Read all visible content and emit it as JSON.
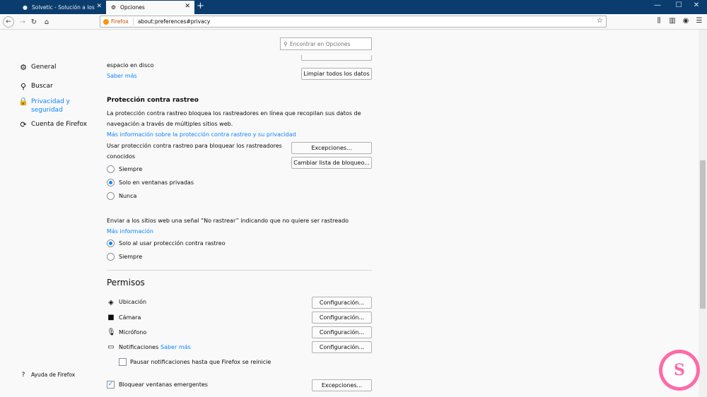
{
  "tabs": [
    {
      "label": "Solvetic - Solución a los proble",
      "icon": "solvetic-favicon"
    },
    {
      "label": "Opciones",
      "icon": "gear-icon"
    }
  ],
  "toolbar": {
    "brand": "Firefox",
    "url": "about:preferences#privacy"
  },
  "sidebar": {
    "items": [
      {
        "label": "General",
        "icon": "gear-icon"
      },
      {
        "label": "Buscar",
        "icon": "search-icon"
      },
      {
        "label": "Privacidad y seguridad",
        "icon": "lock-icon"
      },
      {
        "label": "Cuenta de Firefox",
        "icon": "sync-icon"
      }
    ],
    "help": "Ayuda de Firefox"
  },
  "search": {
    "placeholder": "Encontrar en Opciones"
  },
  "cache": {
    "text": "espacio en disco",
    "learn_more": "Saber más",
    "clear_button": "Limpiar todos los datos"
  },
  "tracking": {
    "title": "Protección contra rastreo",
    "desc_line1": "La protección contra rastreo bloquea los rastreadores en línea que recopilan sus datos de",
    "desc_line2": "navegación a través de múltiples sitios web.",
    "more_info": "Más información sobre la protección contra rastreo y su privacidad",
    "use_line1": "Usar protección contra rastreo para bloquear los rastreadores",
    "use_line2": "conocidos",
    "exceptions_button": "Excepciones...",
    "change_list_button": "Cambiar lista de bloqueo...",
    "options": [
      "Siempre",
      "Solo en ventanas privadas",
      "Nunca"
    ],
    "selected": 1
  },
  "dnt": {
    "text": "Enviar a los sitios web una señal “No rastrear” indicando que no quiere ser rastreado",
    "more_info": "Más información",
    "options": [
      "Solo al usar protección contra rastreo",
      "Siempre"
    ],
    "selected": 0
  },
  "permissions": {
    "title": "Permisos",
    "items": [
      {
        "label": "Ubicación",
        "icon": "location-icon",
        "button": "Configuración..."
      },
      {
        "label": "Cámara",
        "icon": "camera-icon",
        "button": "Configuración..."
      },
      {
        "label": "Micrófono",
        "icon": "microphone-icon",
        "button": "Configuración..."
      },
      {
        "label": "Notificaciones",
        "icon": "notification-icon",
        "button": "Configuración..."
      }
    ],
    "notif_learn_more": "Saber más",
    "pause_notifications": "Pausar notificaciones hasta que Firefox se reinicie",
    "block_popups": "Bloquear ventanas emergentes",
    "block_popups_checked": true,
    "popups_button": "Excepciones..."
  },
  "watermark": {
    "letter": "S",
    "name": "Solvetic"
  }
}
